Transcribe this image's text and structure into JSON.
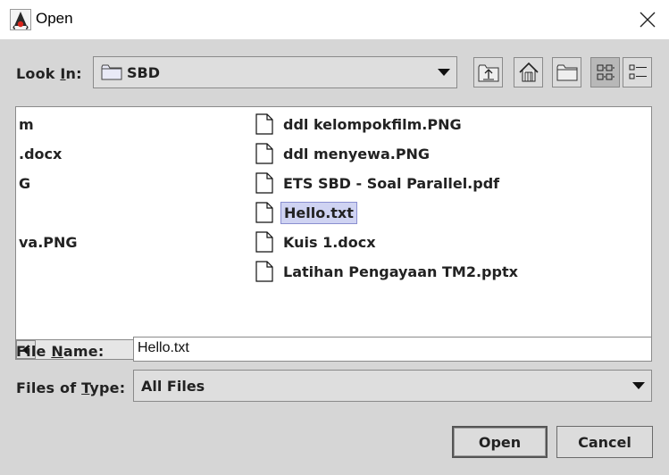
{
  "window": {
    "title": "Open",
    "app_icon": "java-duke-icon",
    "close_icon": "close-icon"
  },
  "look_in": {
    "label_before": "Look ",
    "label_mnemonic": "I",
    "label_after": "n:",
    "value": "SBD",
    "value_icon": "folder-icon",
    "dropdown_icon": "chevron-down-icon"
  },
  "toolbar": {
    "buttons": [
      {
        "name": "up-one-level-button",
        "icon": "up-folder-icon"
      },
      {
        "name": "home-button",
        "icon": "home-icon"
      },
      {
        "name": "new-folder-button",
        "icon": "new-folder-icon"
      },
      {
        "name": "list-view-button",
        "icon": "list-view-icon",
        "active": true
      },
      {
        "name": "details-view-button",
        "icon": "details-view-icon",
        "active": false
      }
    ]
  },
  "files": {
    "left_column": [
      "m",
      ".docx",
      "G",
      "",
      "va.PNG",
      ""
    ],
    "right_column": [
      "ddl kelompokfilm.PNG",
      "ddl menyewa.PNG",
      "ETS SBD - Soal Parallel.pdf",
      "Hello.txt",
      "Kuis 1.docx",
      "Latihan Pengayaan TM2.pptx"
    ],
    "selected": "Hello.txt",
    "file_icon": "file-icon"
  },
  "file_name": {
    "label_before": "File ",
    "label_mnemonic": "N",
    "label_after": "ame:",
    "value": "Hello.txt"
  },
  "file_type": {
    "label_before": "Files of ",
    "label_mnemonic": "T",
    "label_after": "ype:",
    "value": "All Files"
  },
  "buttons": {
    "open": "Open",
    "cancel": "Cancel"
  },
  "colors": {
    "panel_bg": "#d6d6d6",
    "selection_bg": "#cfd3f2",
    "scroll_thumb": "#b9bce6"
  }
}
